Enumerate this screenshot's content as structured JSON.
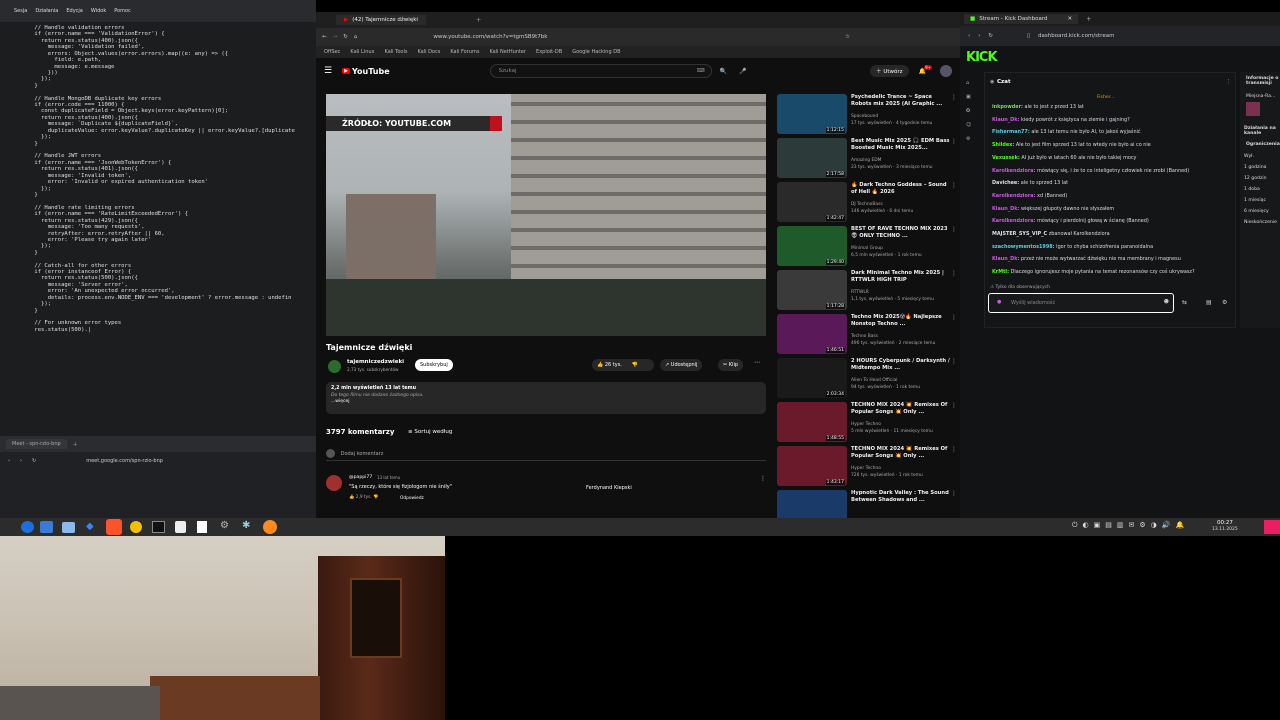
{
  "editor": {
    "menu": [
      "Sesja",
      "Działania",
      "Edycja",
      "Widok",
      "Pomoc"
    ],
    "code": [
      "    // Handle validation errors",
      "    if (error.name === 'ValidationError') {",
      "      return res.status(400).json({",
      "        message: 'Validation failed',",
      "        errors: Object.values(error.errors).map((e: any) => ({",
      "          field: e.path,",
      "          message: e.message",
      "        }))",
      "      });",
      "    }",
      "",
      "    // Handle MongoDB duplicate key errors",
      "    if (error.code === 11000) {",
      "      const duplicateField = Object.keys(error.keyPattern)[0];",
      "      return res.status(400).json({",
      "        message: `Duplicate ${duplicateField}`,",
      "        duplicateValue: error.keyValue?.duplicateKey || error.keyValue?.[duplicate",
      "      });",
      "    }",
      "",
      "    // Handle JWT errors",
      "    if (error.name === 'JsonWebTokenError') {",
      "      return res.status(401).json({",
      "        message: 'Invalid token',",
      "        error: 'Invalid or expired authentication token'",
      "      });",
      "    }",
      "",
      "    // Handle rate limiting errors",
      "    if (error.name === 'RateLimitExceededError') {",
      "      return res.status(429).json({",
      "        message: 'Too many requests',",
      "        retryAfter: error.retryAfter || 60,",
      "        error: 'Please try again later'",
      "      });",
      "    }",
      "",
      "    // Catch-all for other errors",
      "    if (error instanceof Error) {",
      "      return res.status(500).json({",
      "        message: 'Server error',",
      "        error: 'An unexpected error occurred',",
      "        details: process.env.NODE_ENV === 'development' ? error.message : undefin",
      "      });",
      "    }",
      "",
      "    // For unknown error types",
      "    res.status(500).|"
    ]
  },
  "meet": {
    "tab": "Meet - spn-rzio-bnp",
    "url": "meet.google.com/spn-rzio-bnp"
  },
  "youtube": {
    "tab": "(42) Tajemnicze dźwięki",
    "url": "www.youtube.com/watch?v=tgmSB9t7bk",
    "bookmarks": [
      "OffSec",
      "Kali Linux",
      "Kali Tools",
      "Kali Docs",
      "Kali Forums",
      "Kali NetHunter",
      "Exploit-DB",
      "Google Hacking DB"
    ],
    "logo": "YouTube",
    "search_placeholder": "Szukaj",
    "create_label": "Utwórz",
    "notif_count": "9+",
    "video_overlay": "ŹRÓDŁO: YOUTUBE.COM",
    "title": "Tajemnicze dźwięki",
    "channel": "tajemniczedzwieki",
    "subs": "2,73 tys. subskrybentów",
    "subscribe": "Subskrybuj",
    "likes": "26 tys.",
    "share": "Udostępnij",
    "clip": "Klip",
    "views": "2,2 mln wyświetleń  13 lat temu",
    "desc": "Do tego filmu nie dodano żadnego opisu.",
    "more": "...więcej",
    "comments_count": "3797 komentarzy",
    "sort": "Sortuj według",
    "add_comment": "Dodaj komentarz",
    "comment_user": "@pappi77",
    "comment_time": "13 lat temu",
    "comment_text": "\"Są rzeczy, które się fizjologom nie śniły\"",
    "comment_likes": "2,9 tys.",
    "comment_reply": "Odpowiedz",
    "comment_reply_by": "Ferdynand Kiepski",
    "sidebar": [
      {
        "title": "Psychedelic Trance ~ Space Robots mix 2025 (AI Graphic ...",
        "channel": "Spacebound",
        "meta": "17 tys. wyświetleń · 4 tygodnie temu",
        "dur": "1:12:15",
        "color": "#1a4a6a"
      },
      {
        "title": "Best Music Mix 2025 🎧 EDM Bass Boosted Music Mix 2025...",
        "channel": "Amazing EDM",
        "meta": "23 tys. wyświetleń · 3 miesiące temu",
        "dur": "2:17:58",
        "color": "#2d3a3a"
      },
      {
        "title": "🔥 Dark Techno Goddess – Sound of Hell 🔥 2026",
        "channel": "DJ TechnoBass",
        "meta": "146 wyświetleń · 6 dni temu",
        "dur": "1:42:47",
        "color": "#2a2a2a"
      },
      {
        "title": "BEST OF RAVE TECHNO MIX 2023 👽 ONLY TECHNO ...",
        "channel": "Minimal Group",
        "meta": "6,5 mln wyświetleń · 1 rok temu",
        "dur": "1:29:40",
        "color": "#1f5a2a"
      },
      {
        "title": "Dark Minimal Techno Mix 2025 | RTTWLR HIGH TRIP",
        "channel": "RTTWLR",
        "meta": "1,1 tys. wyświetleń · 5 miesięcy temu",
        "dur": "1:17:28",
        "color": "#3a3a3a"
      },
      {
        "title": "Techno Mix 2025😵🔥 Najlepsze Nonstop Techno ...",
        "channel": "Techno Bass",
        "meta": "496 tys. wyświetleń · 2 miesiące temu",
        "dur": "1:46:51",
        "color": "#5a1a5a"
      },
      {
        "title": "2 HOURS Cyberpunk / Darksynth / Midtempo Mix ...",
        "channel": "Alien To Head Official",
        "meta": "94 tys. wyświetleń · 1 rok temu",
        "dur": "2:03:34",
        "color": "#1a1a1a"
      },
      {
        "title": "TECHNO MIX 2024 💥 Remixes Of Popular Songs 💥 Only ...",
        "channel": "Hyper Techno",
        "meta": "5 mln wyświetleń · 11 miesięcy temu",
        "dur": "1:48:55",
        "color": "#6a1a2a"
      },
      {
        "title": "TECHNO MIX 2024 💥 Remixes Of Popular Songs 💥 Only ...",
        "channel": "Hyper Techno",
        "meta": "726 tys. wyświetleń · 1 rok temu",
        "dur": "1:43:17",
        "color": "#6a1a2a"
      },
      {
        "title": "Hypnotic Dark Valley : The Sound Between Shadows and ...",
        "channel": "",
        "meta": "",
        "dur": "",
        "color": "#1a3a6a"
      }
    ]
  },
  "kick": {
    "tab": "Stream - Kick Dashboard",
    "url": "dashboard.kick.com/stream",
    "logo": "KICK",
    "chat_title": "Czat",
    "pinned": "Fisher...",
    "followers_only": "Tylko dla obserwujących",
    "chat_placeholder": "Wyślij wiadomość",
    "messages": [
      {
        "user": "inkpowder:",
        "text": "ale to jest z przed 13 lat",
        "color": "#7fd36b"
      },
      {
        "user": "Klaun_Dk:",
        "text": "kiedy powrót z księżyca na ziemie i gajning?",
        "color": "#c85be0"
      },
      {
        "user": "Fisherman77:",
        "text": "ale 13 lat temu nie było AI, to jakoś wyjaśnić",
        "color": "#5bd0e0"
      },
      {
        "user": "Shildex:",
        "text": "Ale to jest film sprzed 13 lat to wtedy nie było ai co nie",
        "color": "#53fc18"
      },
      {
        "user": "Vexussek:",
        "text": "AI już było w latach 60 ale nie było takiej mocy",
        "color": "#53fc18"
      },
      {
        "user": "Karolkendziora:",
        "text": "mówiący się, i że to co inteligetny człowiek nie zrobi (Banned)",
        "color": "#c85be0"
      },
      {
        "user": "Davichee:",
        "text": "ale to sprzed 13 lat",
        "color": "#e0e0e0"
      },
      {
        "user": "Karolkendziora:",
        "text": "xd (Banned)",
        "color": "#c85be0"
      },
      {
        "user": "Klaun_Dk:",
        "text": "większej głupoty dawno nie słyszałem",
        "color": "#c85be0"
      },
      {
        "user": "Karolkendziora:",
        "text": "mówiący i pierdolnij głową w ścianę (Banned)",
        "color": "#c85be0"
      },
      {
        "user": "MAJSTER_SYS_VIP_C",
        "text": "zbanował Karolkendziora",
        "color": "#e0e0e0"
      },
      {
        "user": "szachowymentos1998:",
        "text": "Igor to chyba schizofrenia paranoidalna",
        "color": "#5bd0e0"
      },
      {
        "user": "Klaun_Dk:",
        "text": "przeż nie może wytwarzać dźwięku nie ma membrany i magnesu",
        "color": "#c85be0"
      },
      {
        "user": "KrMtl:",
        "text": "Dlaczego ignorujesz moje pytania na temat rezonansów czy coś ukrywasz?",
        "color": "#53fc18"
      }
    ],
    "right_panel": {
      "info": "Informacje o transmisji",
      "mini": "Miejsna-Ra...",
      "actions": "Działania na kanale",
      "restrict": "Ograniczenia",
      "options": [
        "Wył.",
        "1 godzina",
        "12 godzin",
        "1 doba",
        "1 miesiąc",
        "6 miesięcy",
        "Nieskończenie"
      ]
    }
  },
  "taskbar": {
    "time": "00:27",
    "date": "13.11.2025"
  }
}
